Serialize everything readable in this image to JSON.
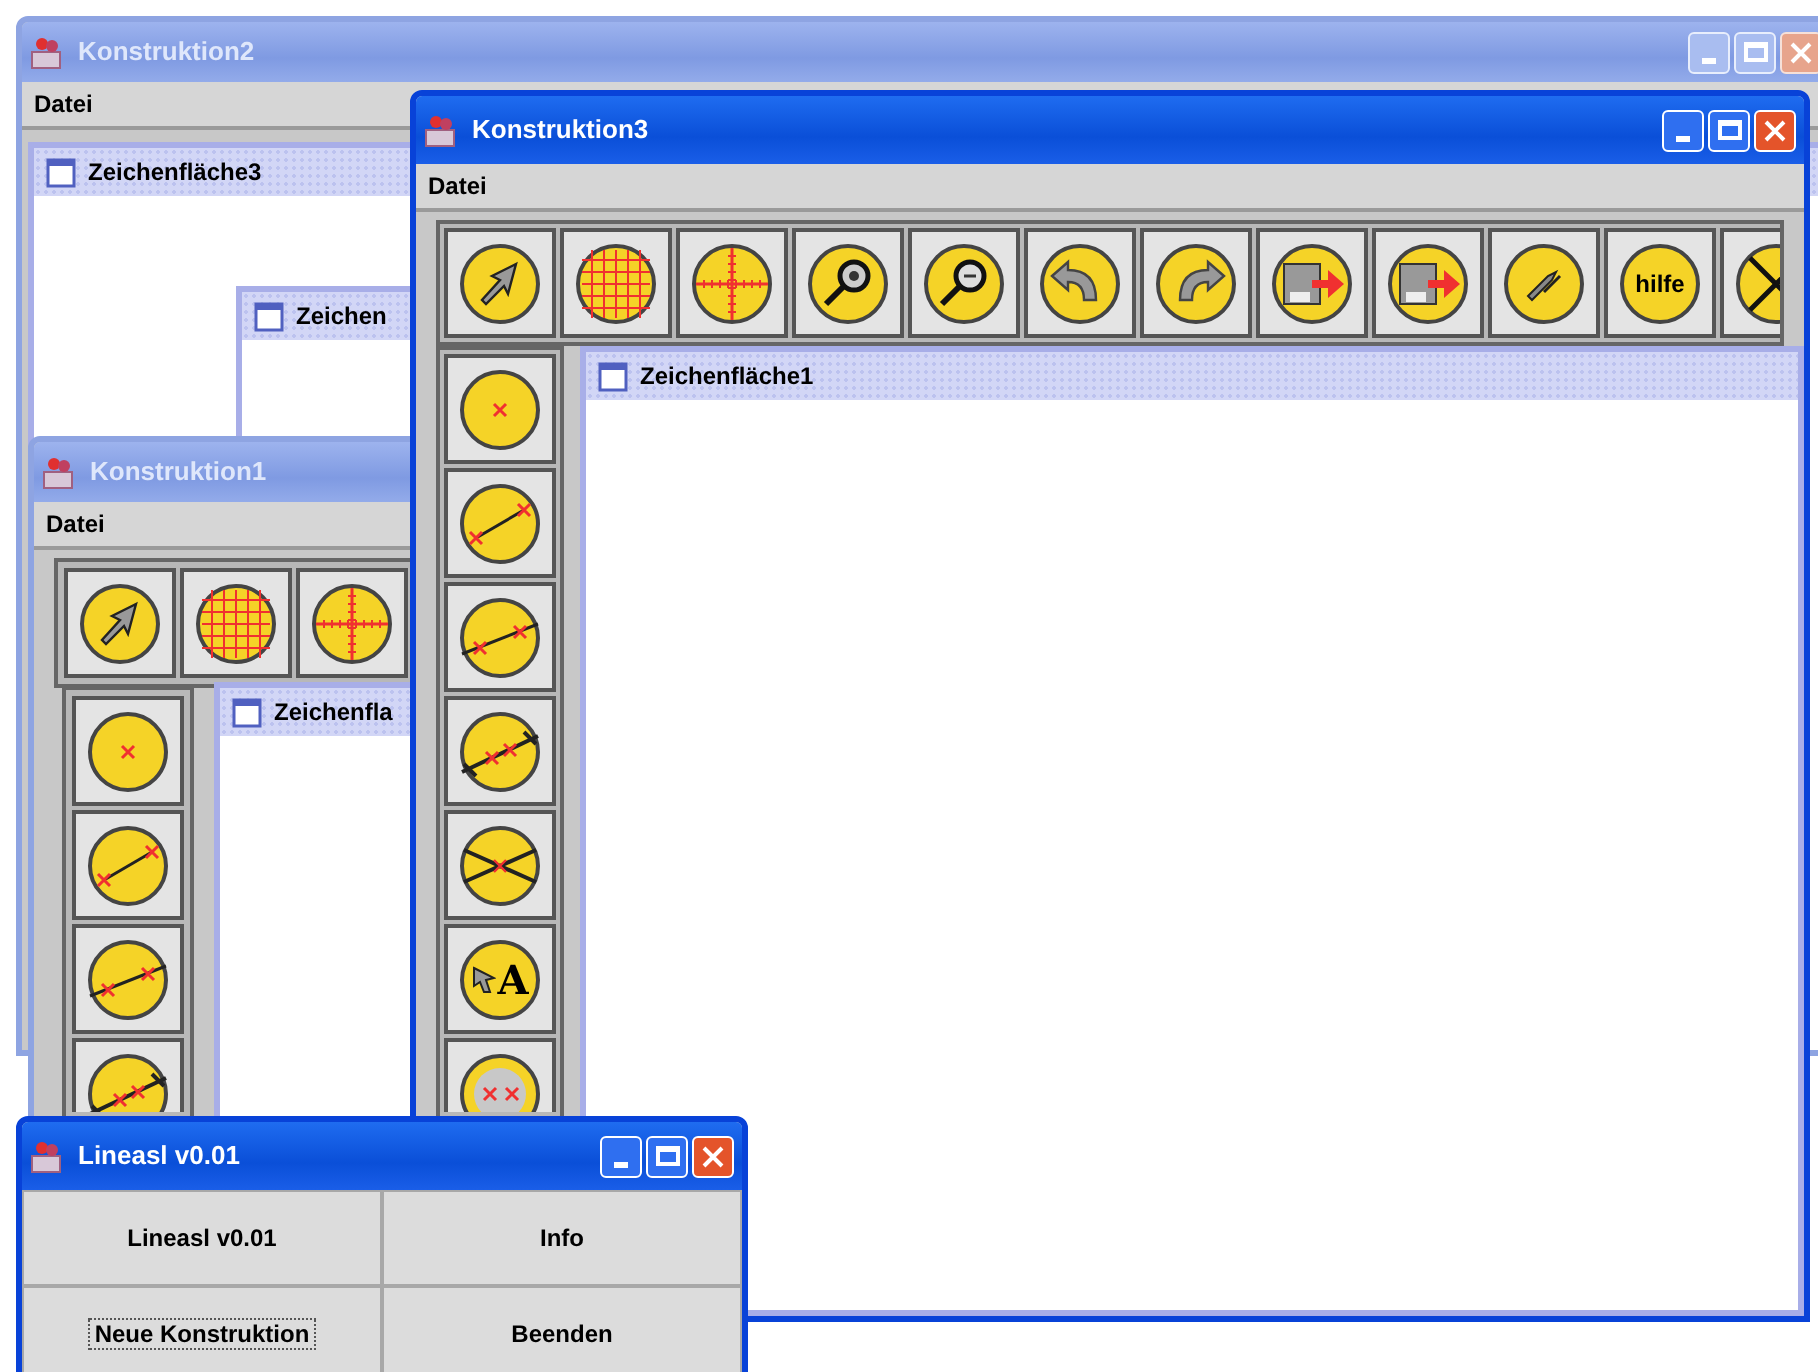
{
  "windows": [
    {
      "kind": "frame",
      "title": "Konstruktion2",
      "active": false,
      "menu": [
        "Datei"
      ],
      "internal_frames": [
        {
          "title": "Zeichenfläche3"
        },
        {
          "title": "Zeichen"
        }
      ]
    },
    {
      "kind": "frame",
      "title": "Konstruktion1",
      "active": false,
      "menu": [
        "Datei"
      ],
      "internal_frames": [
        {
          "title": "Zeichenfla"
        }
      ]
    },
    {
      "kind": "frame",
      "title": "Konstruktion3",
      "active": true,
      "menu": [
        "Datei"
      ],
      "help_icon_text": "hilfe",
      "text_tool_letter": "A",
      "internal_frames": [
        {
          "title": "Zeichenfläche1"
        }
      ]
    },
    {
      "kind": "launcher",
      "title": "Lineasl v0.01",
      "active": true,
      "buttons": [
        {
          "label": "Lineasl v0.01",
          "focused": false
        },
        {
          "label": "Info",
          "focused": false
        },
        {
          "label": "Neue Konstruktion",
          "focused": true
        },
        {
          "label": "Beenden",
          "focused": false
        }
      ]
    }
  ]
}
